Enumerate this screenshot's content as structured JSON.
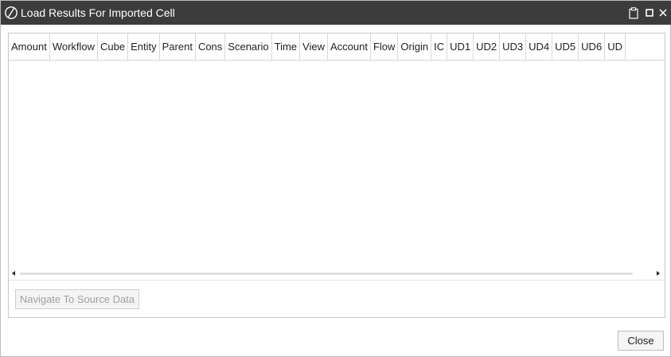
{
  "window": {
    "title": "Load Results For Imported Cell",
    "logo_icon": "brand-logo-icon",
    "controls": {
      "clipboard_icon": "clipboard-icon",
      "maximize_icon": "maximize-icon",
      "close_icon": "close-icon",
      "close_glyph": "×"
    }
  },
  "grid": {
    "columns": [
      "Amount",
      "Workflow",
      "Cube",
      "Entity",
      "Parent",
      "Cons",
      "Scenario",
      "Time",
      "View",
      "Account",
      "Flow",
      "Origin",
      "IC",
      "UD1",
      "UD2",
      "UD3",
      "UD4",
      "UD5",
      "UD6",
      "UD"
    ],
    "rows": []
  },
  "actions": {
    "navigate_label": "Navigate To Source Data",
    "close_label": "Close"
  },
  "colors": {
    "titlebar": "#3c3c3c",
    "border": "#c8c8c8",
    "disabled_text": "#a0a0a0"
  }
}
